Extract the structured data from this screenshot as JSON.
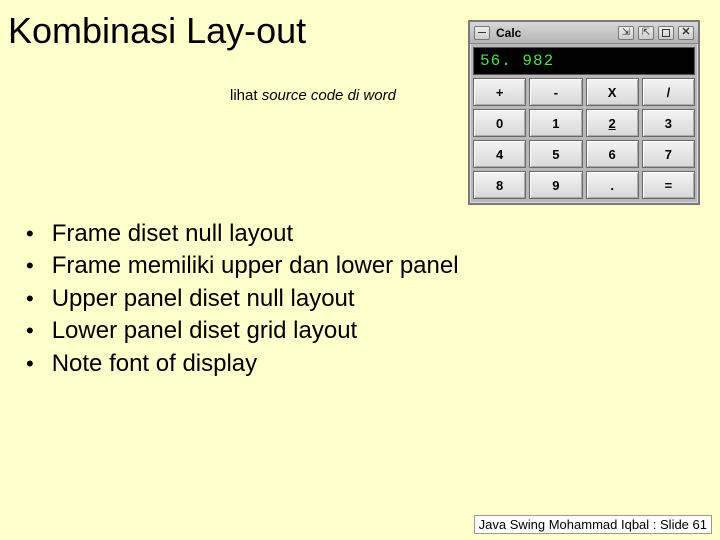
{
  "title": "Kombinasi Lay-out",
  "subtitle_plain": "lihat ",
  "subtitle_italic": "source code di word",
  "bullets": [
    "Frame diset null layout",
    "Frame memiliki upper dan lower panel",
    "Upper panel diset null layout",
    "Lower panel diset grid layout",
    "Note font of display"
  ],
  "footer": "Java Swing Mohammad Iqbal : Slide 61",
  "calc": {
    "title": "Calc",
    "display": "56. 982",
    "keys": [
      "+",
      "-",
      "X",
      "/",
      "0",
      "1",
      "2",
      "3",
      "4",
      "5",
      "6",
      "7",
      "8",
      "9",
      ".",
      "="
    ]
  }
}
